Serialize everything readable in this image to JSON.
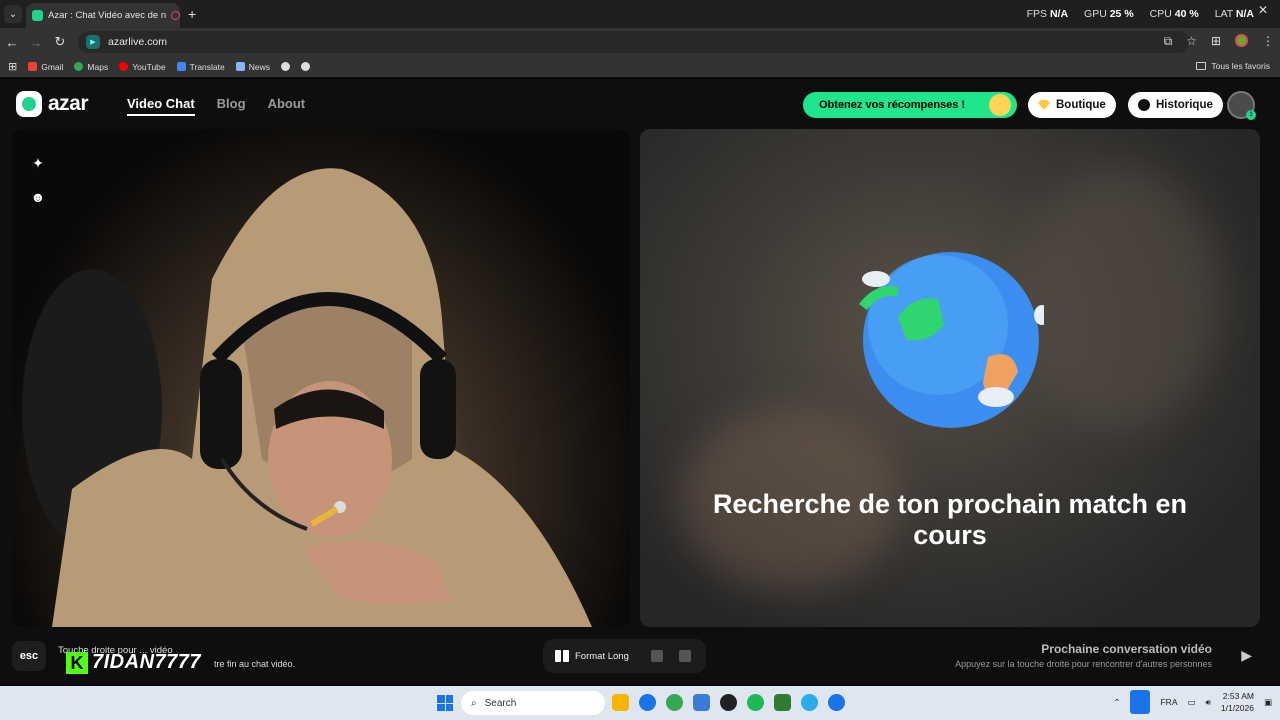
{
  "browser": {
    "tab_title": "Azar : Chat Vidéo avec de n",
    "url": "azarlive.com",
    "bookmarks": [
      "Gmail",
      "Maps",
      "YouTube",
      "Translate",
      "News"
    ],
    "all_bookmarks": "Tous les favoris",
    "perf": {
      "fps_label": "FPS",
      "fps": "N/A",
      "gpu_label": "GPU",
      "gpu": "25 %",
      "cpu_label": "CPU",
      "cpu": "40 %",
      "lat_label": "LAT",
      "lat": "N/A"
    }
  },
  "azar": {
    "logo": "azar",
    "nav": {
      "video_chat": "Video Chat",
      "blog": "Blog",
      "about": "About"
    },
    "reward_label": "Obtenez vos récompenses !",
    "shop_label": "Boutique",
    "history_label": "Historique",
    "avatar_badge": "1",
    "searching_text": "Recherche de ton prochain match en cours",
    "esc_key": "esc",
    "esc_hint": "Touche droite pour ... vidéo",
    "esc_hint_end": "tre fin au chat vidéo.",
    "watermark_letter": "K",
    "watermark_name": "7IDAN7777",
    "format_label": "Format Long",
    "next_title": "Prochaine conversation vidéo",
    "next_hint": "Appuyez sur la touche droite pour rencontrer d'autres personnes"
  },
  "taskbar": {
    "search_placeholder": "Search",
    "language": "FRA",
    "time": "2:53 AM",
    "date": "1/1/2026",
    "app_colors": [
      "#f4b400",
      "#1a73e8",
      "#34a853",
      "#3a7bd5",
      "#222222",
      "#1db954",
      "#2e7d32",
      "#2aabee",
      "#1a73e8"
    ]
  }
}
